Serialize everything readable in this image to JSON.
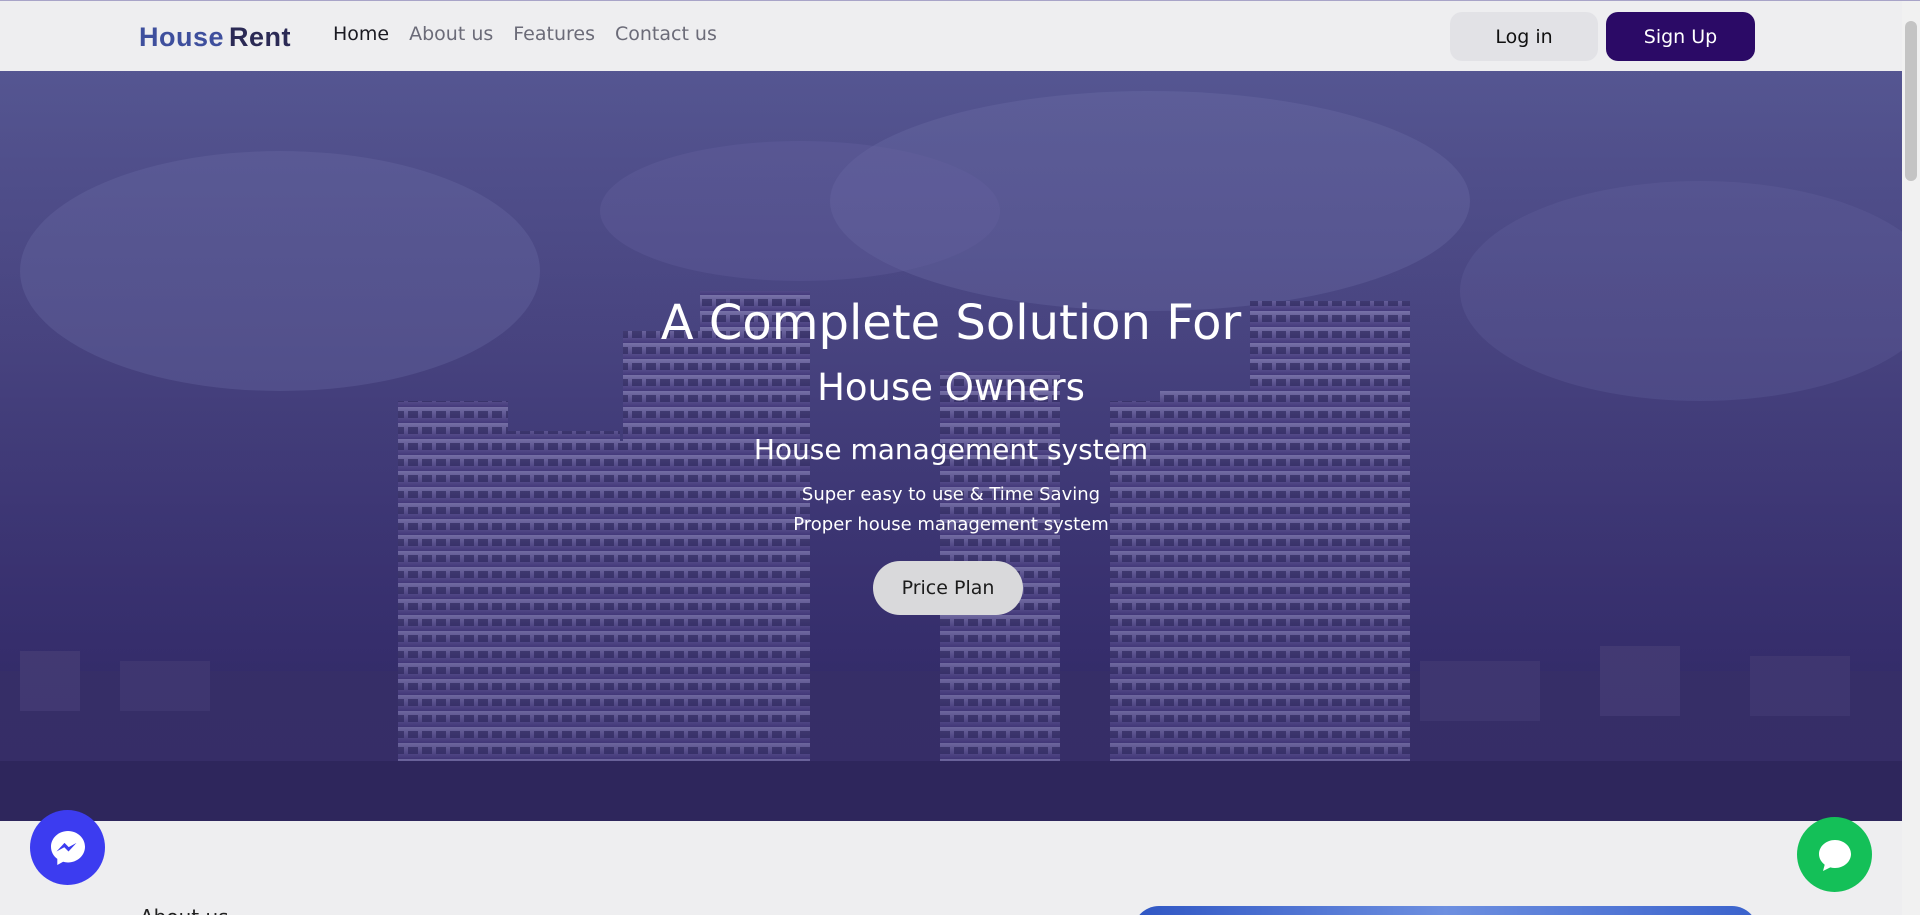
{
  "brand": {
    "house": "House",
    "rent": "Rent"
  },
  "nav": {
    "items": [
      {
        "label": "Home",
        "active": true
      },
      {
        "label": "About us"
      },
      {
        "label": "Features"
      },
      {
        "label": "Contact us"
      }
    ],
    "login_label": "Log in",
    "signup_label": "Sign Up"
  },
  "hero": {
    "title": "A Complete Solution For",
    "subtitle": "House Owners",
    "subtitle2": "House management system",
    "line1": "Super easy to use & Time Saving",
    "line2": "Proper house management system",
    "cta_label": "Price Plan"
  },
  "about": {
    "label": "About us"
  },
  "icons": {
    "messenger": "messenger-icon",
    "chat": "chat-bubble-icon"
  },
  "colors": {
    "brand_blue": "#3e4f9d",
    "signup_bg": "#2b0a66",
    "messenger_bg": "#3c3cf0",
    "chat_bg": "#14c058"
  }
}
